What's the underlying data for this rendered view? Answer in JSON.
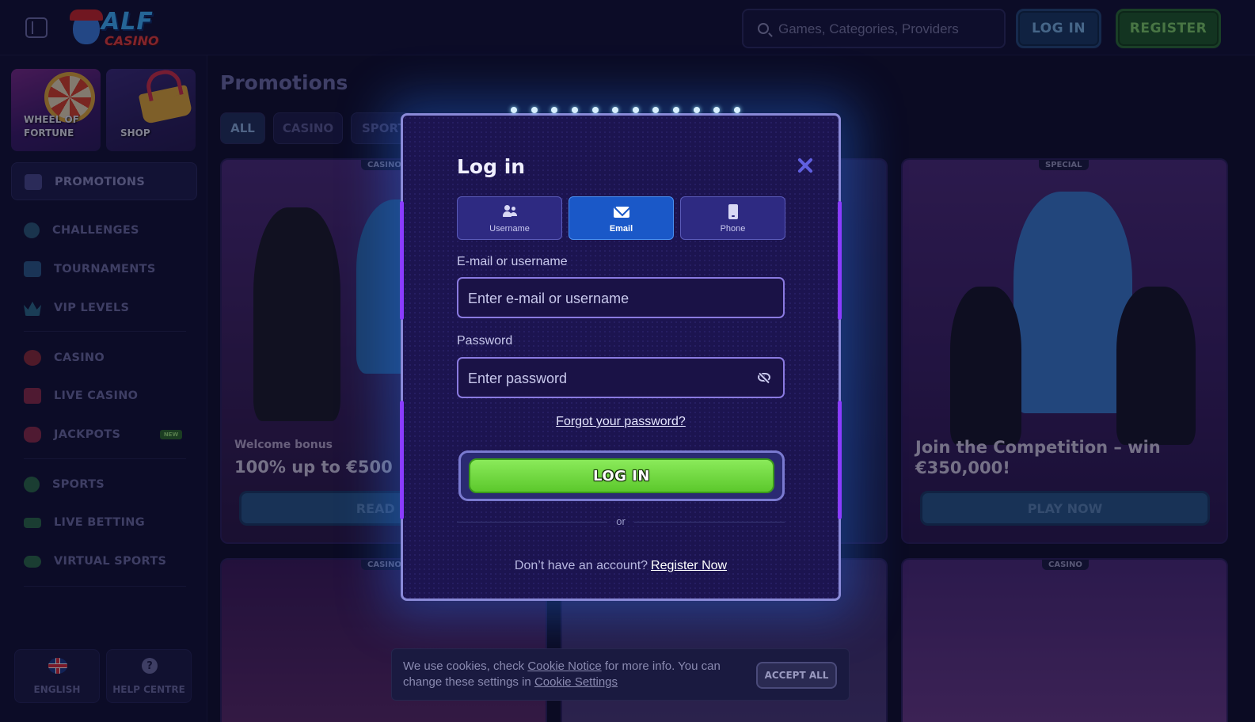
{
  "header": {
    "logo_top": "ALF",
    "logo_bottom": "CASINO",
    "search_placeholder": "Games, Categories, Providers",
    "login_label": "LOG IN",
    "register_label": "REGISTER"
  },
  "sidebar": {
    "tiles": [
      {
        "label": "WHEEL OF\nFORTUNE"
      },
      {
        "label": "SHOP"
      }
    ],
    "promotions_label": "PROMOTIONS",
    "items": [
      {
        "label": "CHALLENGES",
        "icon": "target-icon"
      },
      {
        "label": "TOURNAMENTS",
        "icon": "podium-icon"
      },
      {
        "label": "VIP LEVELS",
        "icon": "crown-icon"
      },
      {
        "label": "CASINO",
        "icon": "cherries-icon"
      },
      {
        "label": "LIVE CASINO",
        "icon": "live-cards-icon"
      },
      {
        "label": "JACKPOTS",
        "icon": "clover-icon",
        "badge": "NEW"
      },
      {
        "label": "SPORTS",
        "icon": "soccer-ball-icon"
      },
      {
        "label": "LIVE BETTING",
        "icon": "live-badge-icon"
      },
      {
        "label": "VIRTUAL SPORTS",
        "icon": "gamepad-icon"
      }
    ],
    "footer": {
      "language_label": "ENGLISH",
      "help_label": "HELP CENTRE",
      "help_glyph": "?"
    }
  },
  "main": {
    "title": "Promotions",
    "filters": [
      "ALL",
      "CASINO",
      "SPORT"
    ],
    "cards": [
      {
        "tag": "CASINO",
        "subtitle": "Welcome bonus",
        "title": "100% up to €500 +",
        "button": "READ M"
      },
      {
        "tag": "",
        "subtitle": "",
        "title": "",
        "button": ""
      },
      {
        "tag": "SPECIAL",
        "subtitle": "",
        "title": "Join the Competition – win €350,000!",
        "button": "PLAY NOW"
      },
      {
        "tag": "CASINO"
      },
      {
        "tag": ""
      },
      {
        "tag": "CASINO"
      }
    ]
  },
  "modal": {
    "title": "Log in",
    "methods": [
      {
        "label": "Username"
      },
      {
        "label": "Email"
      },
      {
        "label": "Phone"
      }
    ],
    "active_method": "Email",
    "email_label": "E-mail or username",
    "email_placeholder": "Enter e-mail or username",
    "password_label": "Password",
    "password_placeholder": "Enter password",
    "forgot_label": "Forgot your password?",
    "submit_label": "LOG IN",
    "or_label": "or",
    "no_account_text": "Don’t have an account?",
    "register_link": "Register Now"
  },
  "cookie": {
    "text_1": "We use cookies, check",
    "link_1": "Cookie Notice",
    "text_2": "for more info. You can change these settings in",
    "link_2": "Cookie Settings",
    "accept_label": "ACCEPT ALL"
  },
  "colors": {
    "background": "#0f0f2e",
    "modal_bg": "#1c1450",
    "active_tab": "#1a58c8",
    "login_green": "#6cd83a",
    "register_green": "#1e5a2a",
    "accent_purple": "#8a3cff"
  }
}
